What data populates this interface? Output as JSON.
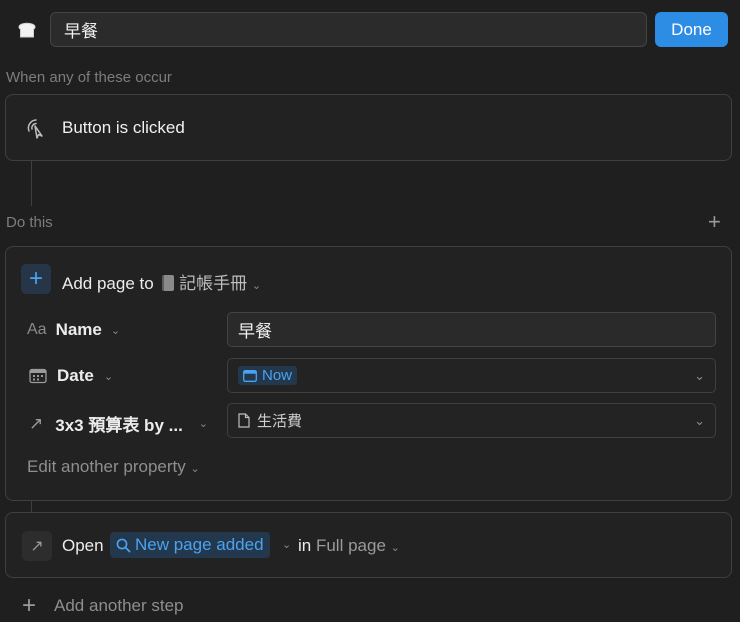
{
  "header": {
    "icon": "bread-icon",
    "title_value": "早餐",
    "done_label": "Done"
  },
  "trigger": {
    "section_label": "When any of these occur",
    "icon": "cursor-click-icon",
    "text": "Button is clicked"
  },
  "actions": {
    "section_label": "Do this",
    "add_page": {
      "action_label": "Add page to",
      "database_icon": "notebook-icon",
      "database_name": "記帳手冊",
      "properties": [
        {
          "icon": "Aa",
          "label": "Name",
          "value": "早餐"
        },
        {
          "icon": "calendar-icon",
          "label": "Date",
          "value": "Now"
        },
        {
          "icon": "arrow-up-right-icon",
          "label": "3x3 預算表 by ...",
          "value": "生活費"
        }
      ],
      "edit_another": "Edit another property"
    },
    "open": {
      "label": "Open",
      "target": "New page added",
      "in_label": "in",
      "mode": "Full page"
    },
    "add_step_label": "Add another step"
  },
  "colors": {
    "accent": "#2d8ce3",
    "link": "#4aa3f0",
    "background": "#1f1f1f"
  }
}
